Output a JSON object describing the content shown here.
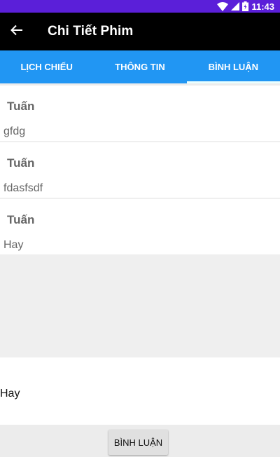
{
  "status_bar": {
    "time": "11:43"
  },
  "app_bar": {
    "title": "Chi Tiết Phim"
  },
  "tabs": [
    {
      "label": "LỊCH CHIẾU",
      "active": false
    },
    {
      "label": "THÔNG TIN",
      "active": false
    },
    {
      "label": "BÌNH LUẬN",
      "active": true
    }
  ],
  "comments": [
    {
      "author": "Tuấn",
      "text": "gfdg"
    },
    {
      "author": "Tuấn",
      "text": "fdasfsdf"
    },
    {
      "author": "Tuấn",
      "text": "Hay"
    }
  ],
  "comment_input": {
    "value": "Hay"
  },
  "submit_button": {
    "label": "BÌNH LUẬN"
  },
  "colors": {
    "status_bar": "#5b1fd9",
    "app_bar": "#000000",
    "tab_bar": "#2196f3",
    "cursor": "#159c8a"
  },
  "icons": {
    "back": "arrow-left-icon",
    "wifi": "wifi-icon",
    "signal": "signal-icon",
    "battery": "battery-icon"
  }
}
